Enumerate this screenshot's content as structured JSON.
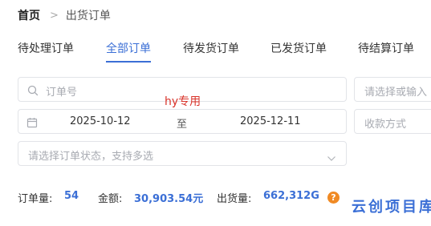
{
  "breadcrumb": {
    "home": "首页",
    "separator": ">",
    "current": "出货订单"
  },
  "tabs": [
    {
      "label": "待处理订单",
      "active": false
    },
    {
      "label": "全部订单",
      "active": true
    },
    {
      "label": "待发货订单",
      "active": false
    },
    {
      "label": "已发货订单",
      "active": false
    },
    {
      "label": "待结算订单",
      "active": false
    }
  ],
  "filters": {
    "order_no_placeholder": "订单号",
    "right_select_placeholder": "请选择或输入",
    "date_start": "2025-10-12",
    "date_to": "至",
    "date_end": "2025-12-11",
    "payment_placeholder": "收款方式",
    "status_placeholder": "请选择订单状态，支持多选"
  },
  "watermark": "hy专用",
  "stats": {
    "order_count_label": "订单量:",
    "order_count": "54",
    "amount_label": "金额:",
    "amount": "30,903.54元",
    "shipped_label": "出货量:",
    "shipped": "662,312G",
    "help": "?"
  },
  "brand": "云创项目库",
  "colors": {
    "accent": "#3b6fd6",
    "warning": "#f08a24",
    "watermark": "#d9342b"
  }
}
